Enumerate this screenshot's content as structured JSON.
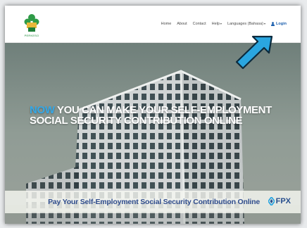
{
  "logo": {
    "name": "perkeso-logo",
    "text": "PERKESO"
  },
  "nav": {
    "items": [
      {
        "label": "Home",
        "has_caret": false
      },
      {
        "label": "About",
        "has_caret": false
      },
      {
        "label": "Contact",
        "has_caret": false
      },
      {
        "label": "Help",
        "has_caret": true
      },
      {
        "label": "Languages (Bahasa)",
        "has_caret": true
      }
    ],
    "login_label": "Login"
  },
  "hero": {
    "headline_highlight": "NOW",
    "headline_rest": "YOU CAN MAKE YOUR SELF-EMPLOYMENT SOCIAL SECURITY CONTRIBUTION ONLINE"
  },
  "banner": {
    "text": "Pay Your Self-Employment Social Security Contribution Online",
    "fpx_label": "FPX"
  },
  "colors": {
    "headline_highlight": "#35a8e6",
    "banner_text": "#2f4c8c",
    "login": "#1b5fae",
    "arrow_fill": "#2aa6e0"
  }
}
